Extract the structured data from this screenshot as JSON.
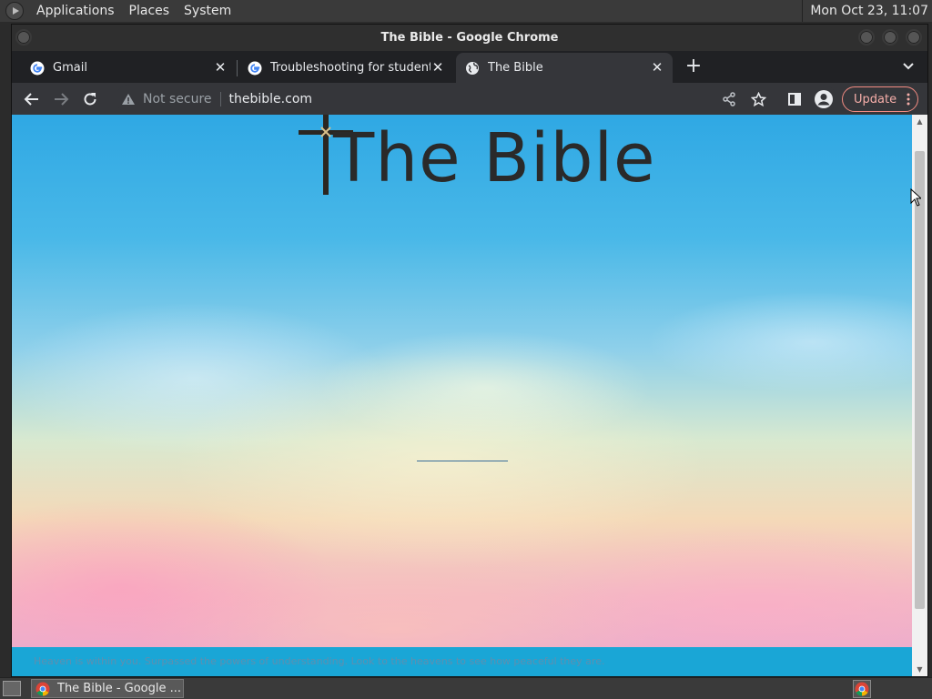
{
  "top_panel": {
    "menus": [
      "Applications",
      "Places",
      "System"
    ],
    "clock": "Mon Oct 23, 11:07"
  },
  "window": {
    "title": "The Bible - Google Chrome"
  },
  "tabs": [
    {
      "title": "Gmail",
      "icon": "google-icon"
    },
    {
      "title": "Troubleshooting for students -",
      "icon": "google-icon"
    },
    {
      "title": "The Bible",
      "icon": "globe-icon"
    }
  ],
  "toolbar": {
    "security_label": "Not secure",
    "url": "thebible.com",
    "update_label": "Update"
  },
  "page": {
    "logo_text": "The Bible",
    "footer_text": "Heaven is within you. Surpassed the powers of understanding. Look to the heavens to see how peaceful they are."
  },
  "taskbar": {
    "task_label": "The Bible - Google ..."
  },
  "colors": {
    "sky_top": "#2fa8e4",
    "footer_band": "#1aa6d6",
    "update_accent": "#f28b82"
  }
}
